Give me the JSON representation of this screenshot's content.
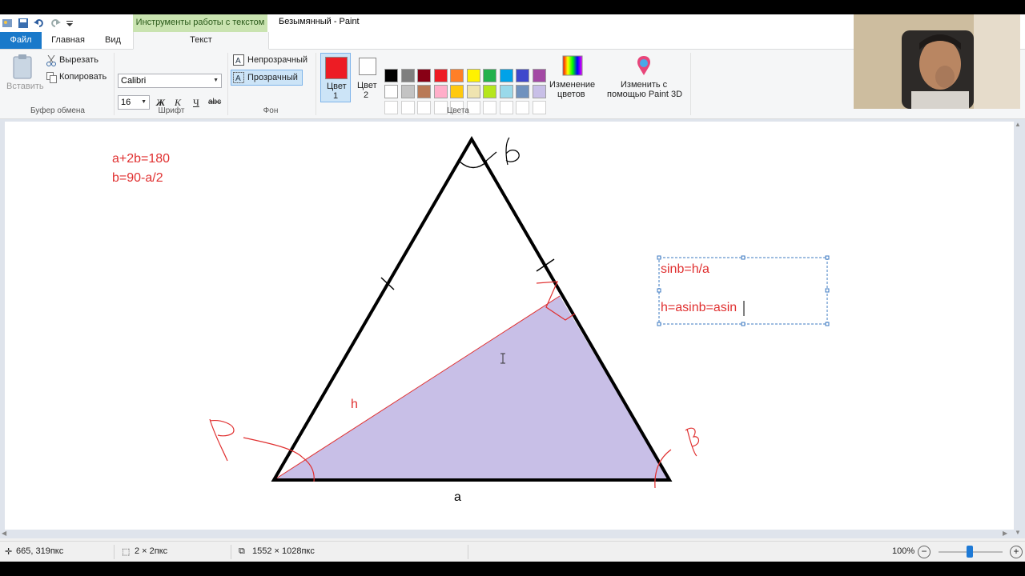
{
  "window": {
    "title": "Безымянный - Paint",
    "context_tab_group": "Инструменты работы с текстом"
  },
  "tabs": {
    "file": "Файл",
    "home": "Главная",
    "view": "Вид",
    "text": "Текст"
  },
  "clipboard": {
    "paste": "Вставить",
    "cut": "Вырезать",
    "copy": "Копировать",
    "group": "Буфер обмена"
  },
  "font": {
    "family": "Calibri",
    "size": "16",
    "bold": "Ж",
    "italic": "К",
    "underline": "Ч",
    "strike": "abc",
    "group": "Шрифт"
  },
  "background": {
    "opaque": "Непрозрачный",
    "transparent": "Прозрачный",
    "group": "Фон"
  },
  "colors": {
    "color1_label": "Цвет 1",
    "color2_label": "Цвет 2",
    "color1_value": "#ed1c24",
    "color2_value": "#ffffff",
    "edit_colors": "Изменение цветов",
    "paint3d": "Изменить с помощью Paint 3D",
    "group": "Цвета",
    "palette_row1": [
      "#000000",
      "#7f7f7f",
      "#880015",
      "#ed1c24",
      "#ff7f27",
      "#fff200",
      "#22b14c",
      "#00a2e8",
      "#3f48cc",
      "#a349a4"
    ],
    "palette_row2": [
      "#ffffff",
      "#c3c3c3",
      "#b97a57",
      "#ffaec9",
      "#ffc90e",
      "#efe4b0",
      "#b5e61d",
      "#99d9ea",
      "#7092be",
      "#c8bfe7"
    ]
  },
  "canvas": {
    "eq1": "a+2b=180",
    "eq2": "b=90-a/2",
    "label_h": "h",
    "label_a": "a",
    "textbox_line1": "sinb=h/a",
    "textbox_line2": "h=asinb=asin",
    "fill_color": "#c8bfe7",
    "text_color": "#e03030"
  },
  "status": {
    "cursor_pos": "665, 319пкс",
    "selection_size": "2 × 2пкс",
    "image_size": "1552 × 1028пкс",
    "zoom": "100%"
  }
}
